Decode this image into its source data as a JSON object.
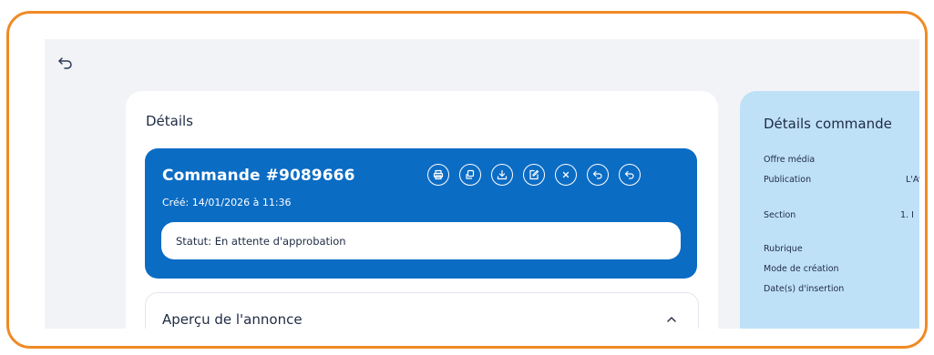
{
  "main": {
    "details_title": "Détails",
    "order": {
      "title": "Commande #9089666",
      "created": "Créé: 14/01/2026 à 11:36",
      "status": "Statut: En attente d'approbation",
      "actions": [
        "print-icon",
        "copy-icon",
        "download-icon",
        "edit-icon",
        "close-icon",
        "undo-icon",
        "undo-icon"
      ]
    },
    "preview": {
      "title": "Aperçu de l'annonce"
    }
  },
  "side": {
    "title": "Détails commande",
    "rows": [
      {
        "label": "Offre média",
        "value": ""
      },
      {
        "label": "Publication",
        "value": "L'Av"
      },
      {
        "label": "Section",
        "value": "1. I"
      },
      {
        "label": "Rubrique",
        "value": ""
      },
      {
        "label": "Mode de création",
        "value": ""
      },
      {
        "label": "Date(s) d'insertion",
        "value": ""
      }
    ]
  },
  "colors": {
    "accent": "#0B6CC4",
    "frame": "#F08A24",
    "side_panel": "#BFE1F8",
    "background": "#F1F3F6"
  }
}
